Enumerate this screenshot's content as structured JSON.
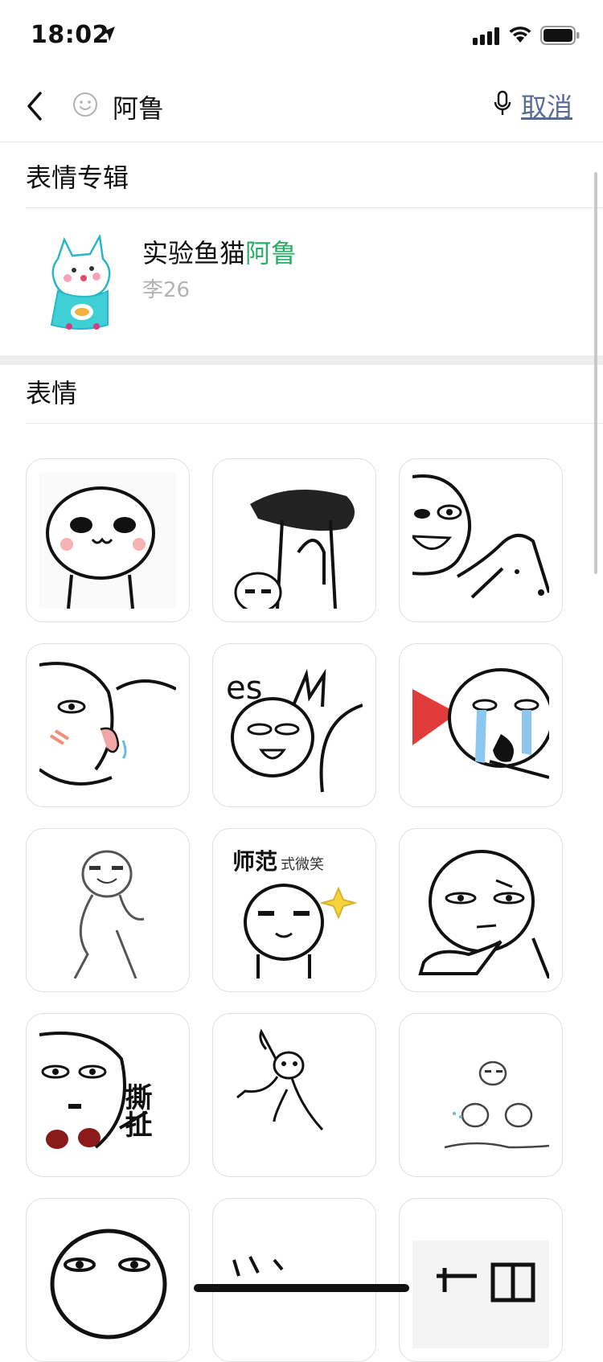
{
  "status_bar": {
    "time": "18:02"
  },
  "search": {
    "query": "阿鲁",
    "cancel_label": "取消"
  },
  "albums_section": {
    "title": "表情专辑",
    "items": [
      {
        "title_prefix": "实验鱼猫",
        "title_highlight": "阿鲁",
        "author": "李26"
      }
    ]
  },
  "stickers_section": {
    "title": "表情",
    "items": [
      {
        "name": "sticker-1"
      },
      {
        "name": "sticker-2"
      },
      {
        "name": "sticker-3"
      },
      {
        "name": "sticker-4"
      },
      {
        "name": "sticker-5"
      },
      {
        "name": "sticker-6"
      },
      {
        "name": "sticker-7",
        "caption": "师范式微笑",
        "caption_main": "师范",
        "caption_sub": "式微笑"
      },
      {
        "name": "sticker-8"
      },
      {
        "name": "sticker-9"
      },
      {
        "name": "sticker-10",
        "caption": "撕扯"
      },
      {
        "name": "sticker-11"
      },
      {
        "name": "sticker-12"
      },
      {
        "name": "sticker-13"
      },
      {
        "name": "sticker-14"
      },
      {
        "name": "sticker-15"
      }
    ]
  },
  "colors": {
    "accent": "#2aae67",
    "link": "#576b95",
    "muted": "#b2b2b2"
  },
  "icons": [
    "location-arrow-icon",
    "signal-icon",
    "wifi-icon",
    "battery-icon",
    "back-chevron-icon",
    "emoji-smile-icon",
    "microphone-icon"
  ]
}
